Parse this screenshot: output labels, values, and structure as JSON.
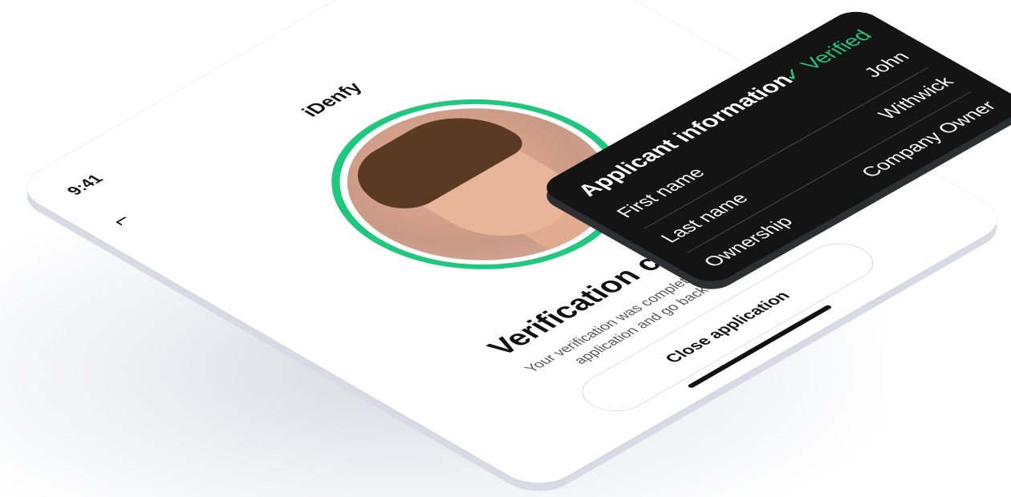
{
  "status_bar": {
    "time": "9:41"
  },
  "header": {
    "back_glyph": "⌐",
    "title": "iDenfy"
  },
  "verification": {
    "check_glyph": "✓",
    "title": "Verification completed",
    "message": "Your verification was completed. You can close the application and go back to the website."
  },
  "actions": {
    "close_label": "Close application"
  },
  "applicant_card": {
    "title": "Applicant information",
    "status": "✓ Verified",
    "rows": [
      {
        "label": "First name",
        "value": "John"
      },
      {
        "label": "Last name",
        "value": "Withwick"
      },
      {
        "label": "Ownership",
        "value": "Company Owner"
      }
    ]
  },
  "colors": {
    "accent": "#22c77f",
    "card_bg": "#141415",
    "text": "#111111"
  },
  "icons": [
    "signal-icon",
    "wifi-icon",
    "battery-icon",
    "back-icon",
    "check-icon"
  ]
}
